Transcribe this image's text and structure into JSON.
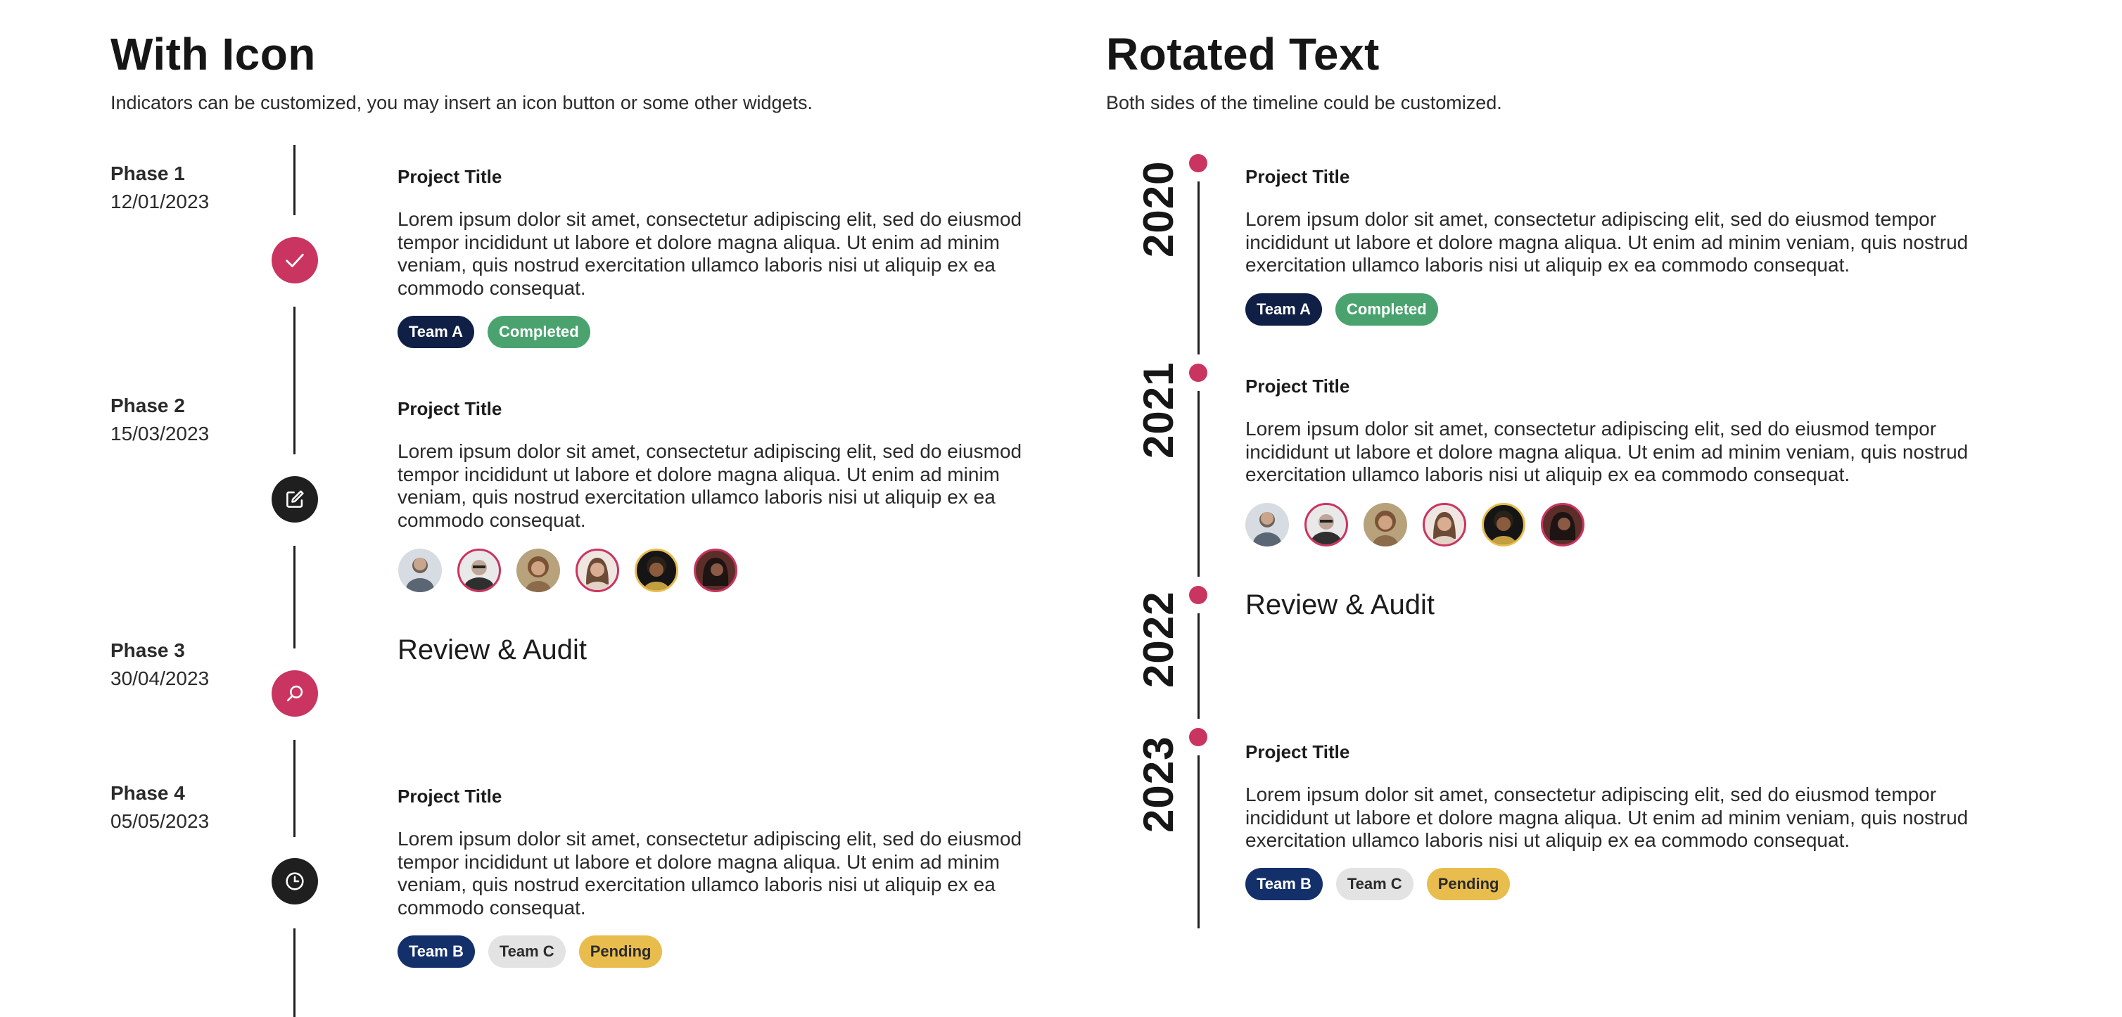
{
  "left": {
    "title": "With Icon",
    "subtitle": "Indicators can be customized, you may insert an icon button or some other widgets.",
    "items": [
      {
        "phase": "Phase 1",
        "date": "12/01/2023",
        "icon": "check-icon",
        "title": "Project Title",
        "body": "Lorem ipsum dolor sit amet, consectetur adipiscing elit, sed do eiusmod tempor incididunt ut labore et dolore magna aliqua. Ut enim ad minim veniam, quis nostrud exercitation ullamco laboris nisi ut aliquip ex ea commodo consequat.",
        "tags": [
          "Team A",
          "Completed"
        ]
      },
      {
        "phase": "Phase 2",
        "date": "15/03/2023",
        "icon": "edit-icon",
        "title": "Project Title",
        "body": "Lorem ipsum dolor sit amet, consectetur adipiscing elit, sed do eiusmod tempor incididunt ut labore et dolore magna aliqua. Ut enim ad minim veniam, quis nostrud exercitation ullamco laboris nisi ut aliquip ex ea commodo consequat."
      },
      {
        "phase": "Phase 3",
        "date": "30/04/2023",
        "icon": "search-icon",
        "heading": "Review & Audit"
      },
      {
        "phase": "Phase 4",
        "date": "05/05/2023",
        "icon": "clock-icon",
        "title": "Project Title",
        "body": "Lorem ipsum dolor sit amet, consectetur adipiscing elit, sed do eiusmod tempor incididunt ut labore et dolore magna aliqua. Ut enim ad minim veniam, quis nostrud exercitation ullamco laboris nisi ut aliquip ex ea commodo consequat.",
        "tags": [
          "Team B",
          "Team C",
          "Pending"
        ]
      }
    ]
  },
  "right": {
    "title": "Rotated Text",
    "subtitle": "Both sides of the timeline could be customized.",
    "items": [
      {
        "year": "2020",
        "title": "Project Title",
        "body": "Lorem ipsum dolor sit amet, consectetur adipiscing elit, sed do eiusmod tempor incididunt ut labore et dolore magna aliqua. Ut enim ad minim veniam, quis nostrud exercitation ullamco laboris nisi ut aliquip ex ea commodo consequat.",
        "tags": [
          "Team A",
          "Completed"
        ]
      },
      {
        "year": "2021",
        "title": "Project Title",
        "body": "Lorem ipsum dolor sit amet, consectetur adipiscing elit, sed do eiusmod tempor incididunt ut labore et dolore magna aliqua. Ut enim ad minim veniam, quis nostrud exercitation ullamco laboris nisi ut aliquip ex ea commodo consequat."
      },
      {
        "year": "2022",
        "heading": "Review & Audit"
      },
      {
        "year": "2023",
        "title": "Project Title",
        "body": "Lorem ipsum dolor sit amet, consectetur adipiscing elit, sed do eiusmod tempor incididunt ut labore et dolore magna aliqua. Ut enim ad minim veniam, quis nostrud exercitation ullamco laboris nisi ut aliquip ex ea commodo consequat.",
        "tags": [
          "Team B",
          "Team C",
          "Pending"
        ]
      }
    ]
  },
  "colors": {
    "accent": "#c93560",
    "dark": "#1f1f1f",
    "team_a": "#0f1f45",
    "team_b": "#14306a",
    "completed": "#4aa36f",
    "team_c": "#e3e3e3",
    "pending": "#e8bd4e"
  }
}
